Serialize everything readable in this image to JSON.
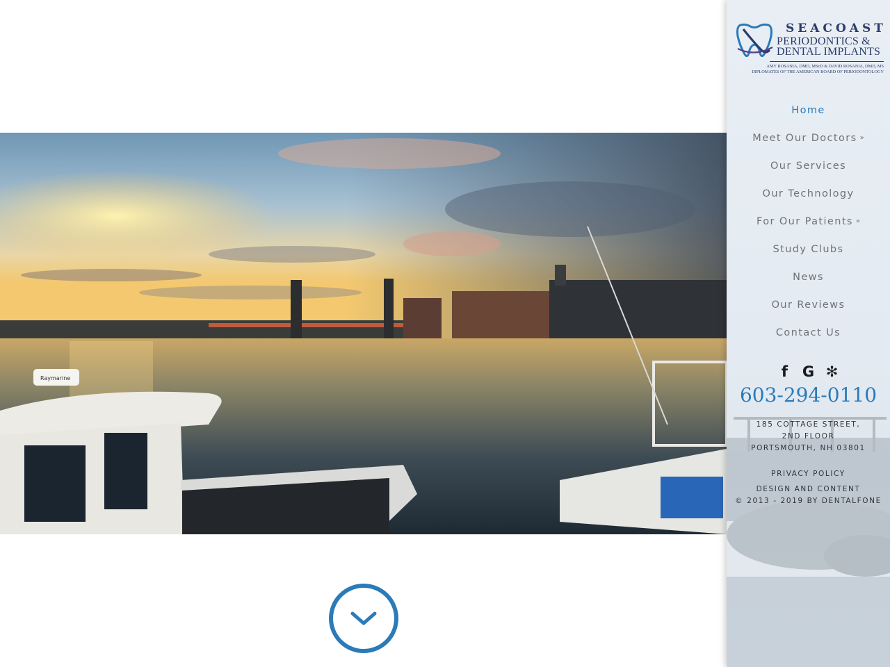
{
  "logo": {
    "line1": "SEACOAST",
    "line2": "PERIODONTICS &",
    "line3": "DENTAL IMPLANTS",
    "line4": "AMY ROSANIA, DMD, MScD & DAVID ROSANIA, DMD, MS",
    "line5": "DIPLOMATES OF THE AMERICAN BOARD OF PERIODONTOLOGY"
  },
  "nav": {
    "items": [
      {
        "label": "Home"
      },
      {
        "label": "Meet Our Doctors"
      },
      {
        "label": "Our Services"
      },
      {
        "label": "Our Technology"
      },
      {
        "label": "For Our Patients"
      },
      {
        "label": "Study Clubs"
      },
      {
        "label": "News"
      },
      {
        "label": "Our Reviews"
      },
      {
        "label": "Contact Us"
      }
    ],
    "active_index": 0,
    "dropdown_glyph": "»"
  },
  "social": {
    "facebook": "f",
    "google": "G",
    "yelp": "✻"
  },
  "contact": {
    "phone": "603-294-0110",
    "address_line1": "185 COTTAGE STREET,",
    "address_line2": "2ND FLOOR",
    "address_line3": "PORTSMOUTH, NH 03801"
  },
  "footer": {
    "privacy": "PRIVACY POLICY",
    "design": "DESIGN AND CONTENT",
    "copyright": "© 2013 - 2019 BY DENTALFONE"
  },
  "hero": {
    "boat_brand": "Raymarine"
  },
  "colors": {
    "accent": "#2a7bb8",
    "nav_text": "#6e7378",
    "logo_navy": "#2b3b6b"
  }
}
